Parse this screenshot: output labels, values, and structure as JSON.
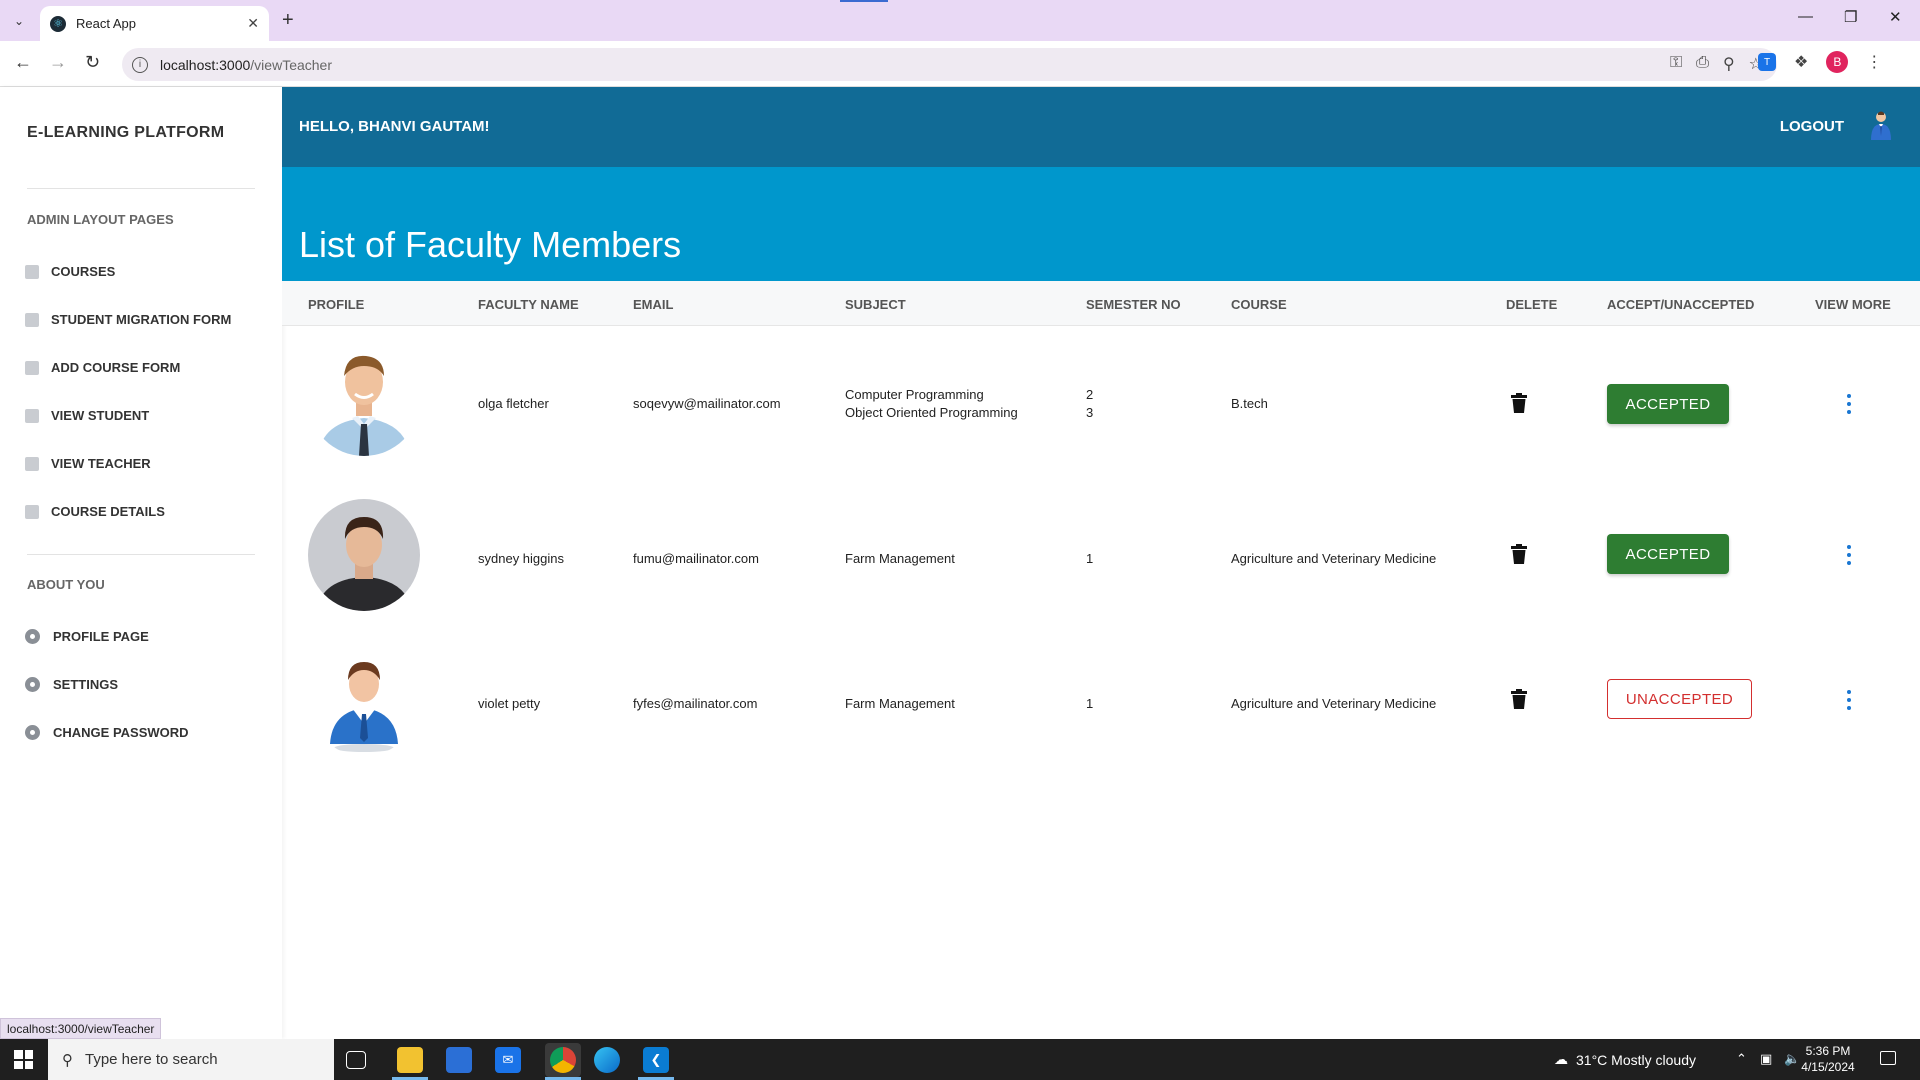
{
  "browser": {
    "tab_title": "React App",
    "url_host": "localhost:3000",
    "url_path": "/viewTeacher",
    "profile_initial": "B",
    "status_url": "localhost:3000/viewTeacher"
  },
  "sidebar": {
    "brand": "E-LEARNING PLATFORM",
    "section_admin": "ADMIN LAYOUT PAGES",
    "admin_items": [
      "COURSES",
      "STUDENT MIGRATION FORM",
      "ADD COURSE FORM",
      "VIEW STUDENT",
      "VIEW TEACHER",
      "COURSE DETAILS"
    ],
    "section_about": "ABOUT YOU",
    "about_items": [
      "PROFILE PAGE",
      "SETTINGS",
      "CHANGE PASSWORD"
    ]
  },
  "header": {
    "greeting": "HELLO, BHANVI GAUTAM!",
    "logout": "LOGOUT"
  },
  "page": {
    "title": "List of Faculty Members"
  },
  "table": {
    "headers": [
      "PROFILE",
      "FACULTY NAME",
      "EMAIL",
      "SUBJECT",
      "SEMESTER NO",
      "COURSE",
      "DELETE",
      "ACCEPT/UNACCEPTED",
      "VIEW MORE"
    ],
    "rows": [
      {
        "name": "olga fletcher",
        "email": "soqevyw@mailinator.com",
        "subject_1": "Computer Programming",
        "subject_2": "Object Oriented Programming",
        "semester_1": "2",
        "semester_2": "3",
        "course": "B.tech",
        "status": "ACCEPTED"
      },
      {
        "name": "sydney higgins",
        "email": "fumu@mailinator.com",
        "subject_1": "Farm Management",
        "semester_1": "1",
        "course": "Agriculture and Veterinary Medicine",
        "status": "ACCEPTED"
      },
      {
        "name": "violet petty",
        "email": "fyfes@mailinator.com",
        "subject_1": "Farm Management",
        "semester_1": "1",
        "course": "Agriculture and Veterinary Medicine",
        "status": "UNACCEPTED"
      }
    ]
  },
  "taskbar": {
    "search_placeholder": "Type here to search",
    "weather": "31°C  Mostly cloudy",
    "time": "5:36 PM",
    "date": "4/15/2024"
  },
  "colors": {
    "topbar": "#116b96",
    "hero": "#0097cc",
    "accepted": "#2e7d32",
    "unaccepted": "#d32f2f",
    "kebab": "#1976d2"
  }
}
